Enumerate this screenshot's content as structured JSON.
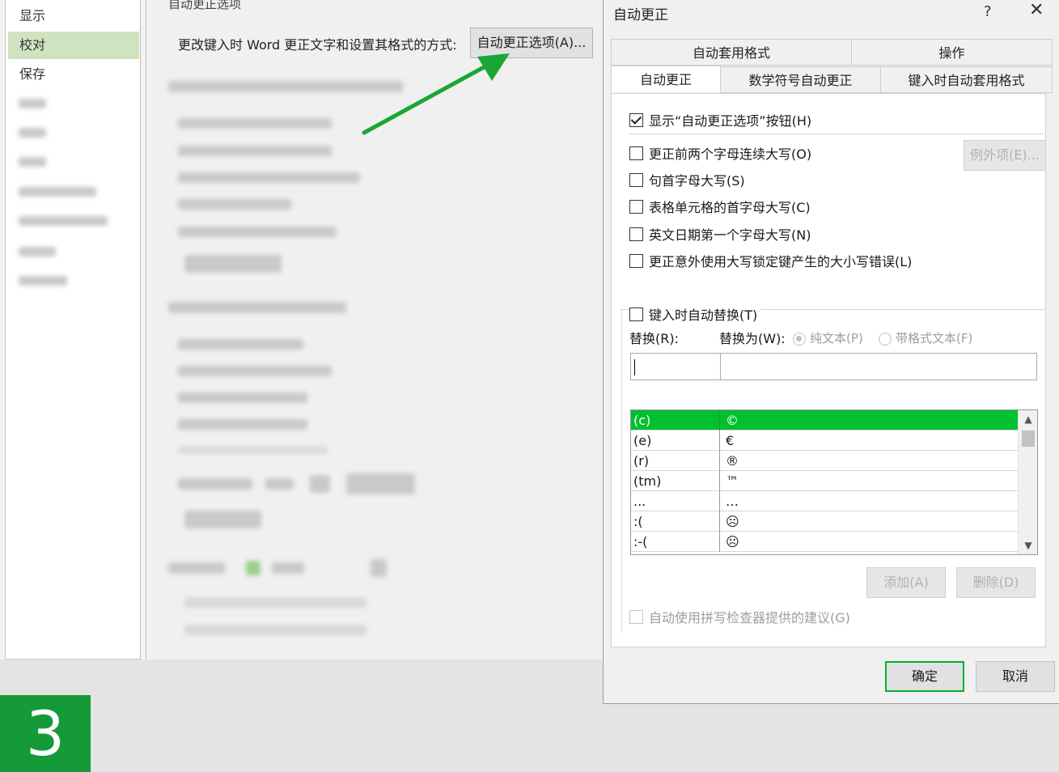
{
  "options_window": {
    "section_title": "自动更正选项",
    "nav_items": [
      "显示",
      "校对",
      "保存"
    ],
    "active_nav": "校对",
    "description": "更改键入时 Word 更正文字和设置其格式的方式:",
    "autocorrect_options_button": "自动更正选项(A)..."
  },
  "dialog": {
    "title": "自动更正",
    "help": "?",
    "close": "✕",
    "tabs_row1": [
      "自动套用格式",
      "操作"
    ],
    "tabs_row2": [
      "自动更正",
      "数学符号自动更正",
      "键入时自动套用格式"
    ],
    "active_tab": "自动更正",
    "checkboxes": {
      "show_buttons": {
        "label": "显示“自动更正选项”按钮(H)",
        "checked": true
      },
      "two_initial_caps": {
        "label": "更正前两个字母连续大写(O)",
        "checked": false
      },
      "sentence_caps": {
        "label": "句首字母大写(S)",
        "checked": false
      },
      "table_cell_caps": {
        "label": "表格单元格的首字母大写(C)",
        "checked": false
      },
      "day_names": {
        "label": "英文日期第一个字母大写(N)",
        "checked": false
      },
      "caps_lock": {
        "label": "更正意外使用大写锁定键产生的大小写错误(L)",
        "checked": false
      },
      "replace_as_type": {
        "label": "键入时自动替换(T)",
        "checked": false
      },
      "spell_suggestions": {
        "label": "自动使用拼写检查器提供的建议(G)",
        "checked": false
      }
    },
    "exceptions_button": "例外项(E)...",
    "replace_label": "替换(R):",
    "with_label": "替换为(W):",
    "plain_text": "纯文本(P)",
    "formatted_text": "带格式文本(F)",
    "entries": [
      {
        "replace": "(c)",
        "with": "©"
      },
      {
        "replace": "(e)",
        "with": "€"
      },
      {
        "replace": "(r)",
        "with": "®"
      },
      {
        "replace": "(tm)",
        "with": "™"
      },
      {
        "replace": "...",
        "with": "…"
      },
      {
        "replace": ":(",
        "with": "☹"
      },
      {
        "replace": ":-(",
        "with": "☹"
      }
    ],
    "selected_entry": "(c)",
    "add_button": "添加(A)",
    "delete_button": "删除(D)",
    "ok_button": "确定",
    "cancel_button": "取消"
  },
  "step_number": "3",
  "colors": {
    "selection": "#00c030",
    "highlight_nav": "#cfe3c1",
    "ok_border": "#00b030",
    "badge": "#159a3a",
    "arrow": "#1aa635"
  }
}
